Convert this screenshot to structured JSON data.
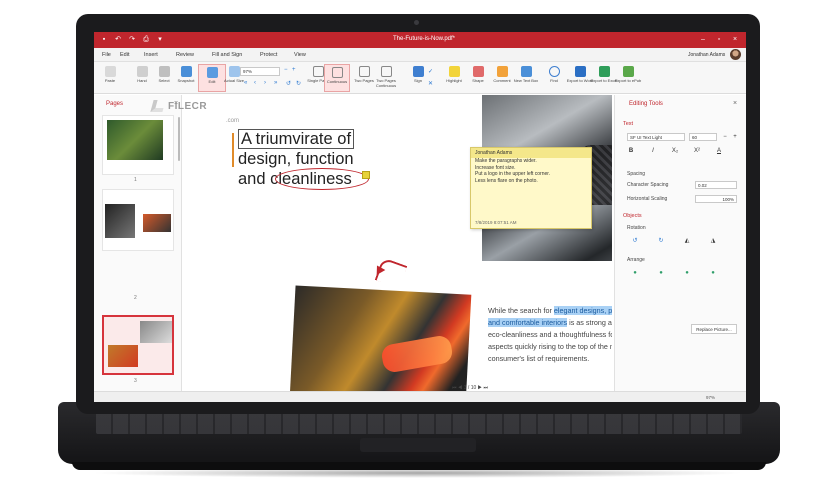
{
  "app": {
    "window_title": "The-Future-is-Now.pdf*",
    "user_name": "Jonathan Adams"
  },
  "menu": [
    "File",
    "Edit",
    "Insert",
    "Review",
    "Fill and Sign",
    "Protect",
    "View"
  ],
  "ribbon": {
    "tools": [
      {
        "label": "Paste",
        "icon": "paste-icon"
      },
      {
        "label": "Hand",
        "icon": "hand-icon"
      },
      {
        "label": "Select",
        "icon": "cursor-icon"
      },
      {
        "label": "Snapshot",
        "icon": "camera-icon"
      },
      {
        "label": "Edit",
        "icon": "edit-icon"
      },
      {
        "label": "Actual Size",
        "icon": "actual-size-icon"
      },
      {
        "label": "Single Page",
        "icon": "single-page-icon"
      },
      {
        "label": "Continuous",
        "icon": "continuous-icon"
      },
      {
        "label": "Two Pages",
        "icon": "two-pages-icon"
      },
      {
        "label": "Two Pages Continuous",
        "icon": "two-pages-continuous-icon"
      },
      {
        "label": "Sign",
        "icon": "sign-icon"
      },
      {
        "label": "Highlight",
        "icon": "highlight-icon"
      },
      {
        "label": "Shape",
        "icon": "shape-icon"
      },
      {
        "label": "Comment",
        "icon": "comment-icon"
      },
      {
        "label": "New Text Box",
        "icon": "text-box-icon"
      },
      {
        "label": "Find",
        "icon": "find-icon"
      },
      {
        "label": "Export to Word",
        "icon": "word-icon"
      },
      {
        "label": "Export to Excel",
        "icon": "excel-icon"
      },
      {
        "label": "Export to ePub",
        "icon": "epub-icon"
      }
    ],
    "zoom": "97%"
  },
  "pages_panel": {
    "title": "Pages",
    "pages": [
      "1",
      "2",
      "3"
    ]
  },
  "document": {
    "headline_1": "A triumvirate of",
    "headline_2": "design, function",
    "headline_3a": "and ",
    "headline_3b": "cleanliness",
    "comment": {
      "author": "Jonathan Adams",
      "lines": [
        "Make the paragraphs wider.",
        "Increase font size.",
        "Put a logo in the upper left corner.",
        "Less lens flare on the photo."
      ],
      "date": "7/8/2019 8:07:51 AM"
    },
    "body_pre": "While the search for ",
    "body_sel1": "elegant designs, powerful",
    "body_sel2": "engines and comfortable interiors",
    "body_post": " is as strong as it ever was, eco-cleanliness and a thoughtfulness for nature are two aspects quickly rising to the top of the modern consumer's list of requirements.",
    "page_nav": "3 / 10"
  },
  "editing_tools": {
    "title": "Editing Tools",
    "text_section": "Text",
    "font": "SF UI Text Light",
    "font_size": "60",
    "spacing_label": "Spacing",
    "char_spacing_label": "Character Spacing",
    "char_spacing_value": "0.02",
    "horiz_scaling_label": "Horizontal Scaling",
    "horiz_scaling_value": "100%",
    "objects_section": "Objects",
    "rotation_label": "Rotation",
    "arrange_label": "Arrange",
    "replace_button": "Replace Picture..."
  },
  "status": {
    "zoom": "97%"
  },
  "watermark": {
    "text": "FILECR",
    "sub": ".com"
  }
}
